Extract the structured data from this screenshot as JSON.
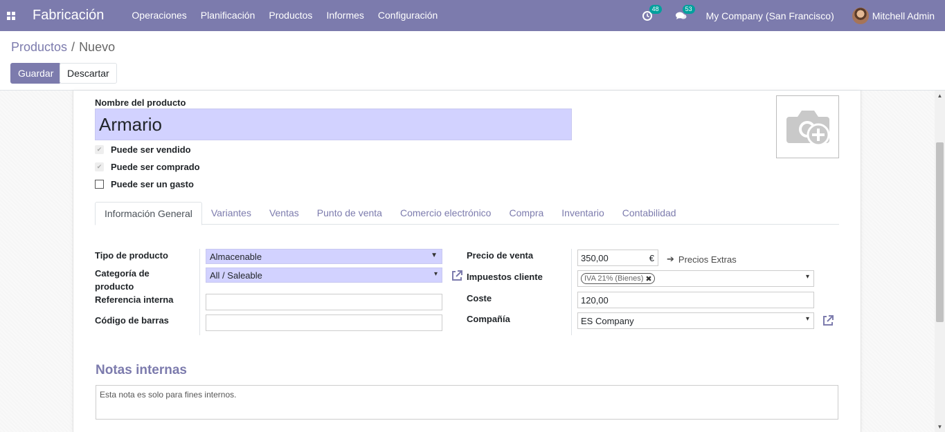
{
  "navbar": {
    "app_name": "Fabricación",
    "menu": [
      "Operaciones",
      "Planificación",
      "Productos",
      "Informes",
      "Configuración"
    ],
    "activity_count": "48",
    "message_count": "53",
    "company": "My Company (San Francisco)",
    "user": "Mitchell Admin"
  },
  "breadcrumb": {
    "parent": "Productos",
    "separator": "/",
    "current": "Nuevo"
  },
  "buttons": {
    "save": "Guardar",
    "discard": "Descartar"
  },
  "form": {
    "name_label": "Nombre del producto",
    "name_value": "Armario",
    "checks": [
      {
        "label": "Puede ser vendido",
        "checked": true
      },
      {
        "label": "Puede ser comprado",
        "checked": true
      },
      {
        "label": "Puede ser un gasto",
        "checked": false
      }
    ],
    "tabs": [
      "Información General",
      "Variantes",
      "Ventas",
      "Punto de venta",
      "Comercio electrónico",
      "Compra",
      "Inventario",
      "Contabilidad"
    ],
    "active_tab": "Información General",
    "left": {
      "type_label": "Tipo de producto",
      "type_value": "Almacenable",
      "category_label_1": "Categoría de",
      "category_label_2": "producto",
      "category_value": "All / Saleable",
      "ref_label": "Referencia interna",
      "ref_value": "",
      "barcode_label": "Código de barras",
      "barcode_value": ""
    },
    "right": {
      "price_label": "Precio de venta",
      "price_value": "350,00",
      "currency": "€",
      "extra_prices": "Precios Extras",
      "tax_label": "Impuestos cliente",
      "tax_tag": "IVA 21% (Bienes)",
      "cost_label": "Coste",
      "cost_value": "120,00",
      "company_label": "Compañía",
      "company_value": "ES Company"
    },
    "notes_title": "Notas internas",
    "notes_placeholder": "Esta nota es solo para fines internos."
  },
  "colors": {
    "brand": "#7c7bad",
    "required_bg": "#d2d2ff",
    "badge": "#00a09d"
  }
}
